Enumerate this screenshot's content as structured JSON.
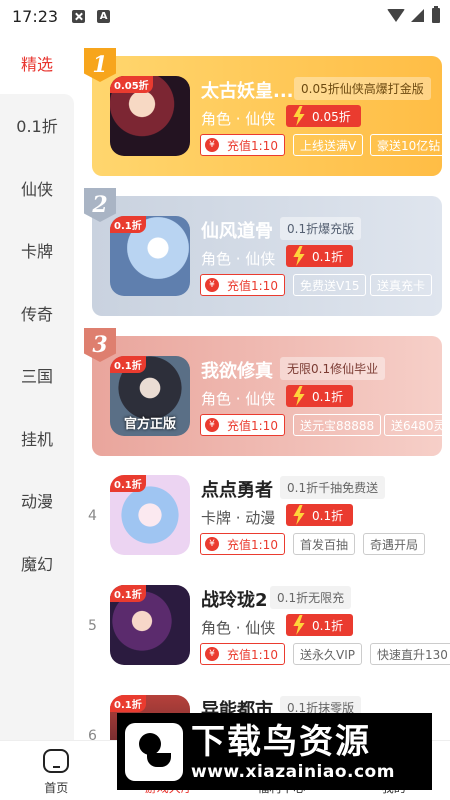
{
  "status_bar": {
    "time": "17:23"
  },
  "sidebar": {
    "active": "精选",
    "items": [
      "0.1折",
      "仙侠",
      "卡牌",
      "传奇",
      "三国",
      "挂机",
      "动漫",
      "魔幻"
    ]
  },
  "games": [
    {
      "rank": "1",
      "title": "太古妖皇...",
      "promo": "0.05折仙侠高爆打金版",
      "genre": "角色 · 仙侠",
      "discount": "0.05折",
      "recharge": "充值1:10",
      "chips": [
        "上线送满V",
        "豪送10亿钻"
      ],
      "icon_tag": "0.05折",
      "icon_caption": ""
    },
    {
      "rank": "2",
      "title": "仙风道骨",
      "promo": "0.1折爆充版",
      "genre": "角色 · 仙侠",
      "discount": "0.1折",
      "recharge": "充值1:10",
      "chips": [
        "免费送V15",
        "送真充卡"
      ],
      "icon_tag": "0.1折",
      "icon_caption": ""
    },
    {
      "rank": "3",
      "title": "我欲修真",
      "promo": "无限0.1修仙毕业",
      "genre": "角色 · 仙侠",
      "discount": "0.1折",
      "recharge": "充值1:10",
      "chips": [
        "送元宝88888",
        "送6480灵"
      ],
      "icon_tag": "0.1折",
      "icon_caption": "官方正版"
    },
    {
      "rank": "4",
      "title": "点点勇者",
      "promo": "0.1折千抽免费送",
      "genre": "卡牌 · 动漫",
      "discount": "0.1折",
      "recharge": "充值1:10",
      "chips": [
        "首发百抽",
        "奇遇开局"
      ],
      "icon_tag": "0.1折",
      "icon_caption": ""
    },
    {
      "rank": "5",
      "title": "战玲珑2",
      "promo": "0.1折无限充",
      "genre": "角色 · 仙侠",
      "discount": "0.1折",
      "recharge": "充值1:10",
      "chips": [
        "送永久VIP",
        "快速直升130"
      ],
      "icon_tag": "0.1折",
      "icon_caption": ""
    },
    {
      "rank": "6",
      "title": "异能都市",
      "promo": "0.1折抹零版",
      "icon_tag": "0.1折"
    }
  ],
  "bottom_nav": {
    "home": "首页",
    "games": "游戏大厅",
    "welfare": "福利中心",
    "mine": "我的"
  },
  "watermark": {
    "brand": "下载鸟资源",
    "url": "www.xiazainiao.com"
  }
}
